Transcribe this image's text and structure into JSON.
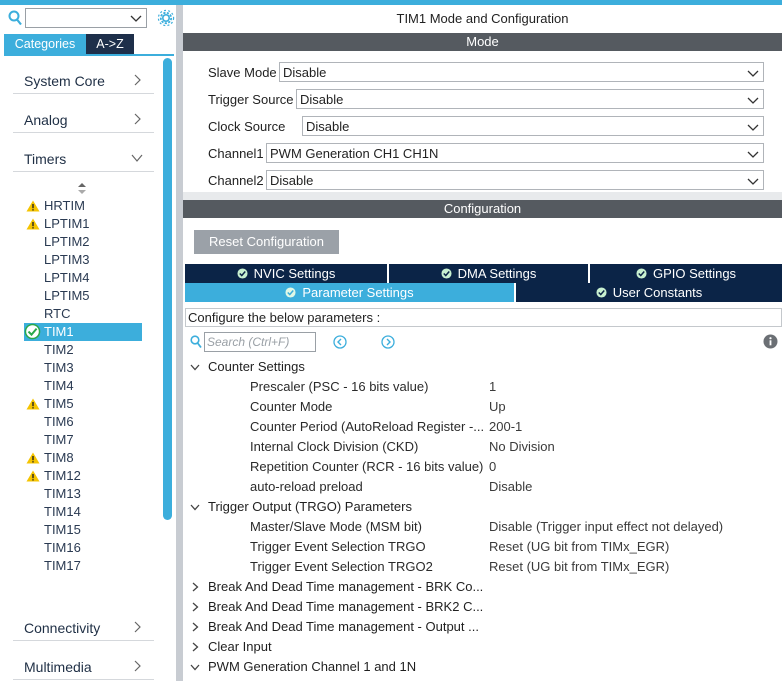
{
  "colors": {
    "accent": "#3caedc",
    "navy": "#0b2447",
    "header_gray": "#555a60",
    "warning": "#f5c400",
    "ok_green": "#2aa84a"
  },
  "sidebar": {
    "search": {
      "value": ""
    },
    "tabs": {
      "categories": "Categories",
      "az": "A->Z"
    },
    "categories": [
      {
        "label": "System Core",
        "icon": "chevron-right-icon"
      },
      {
        "label": "Analog",
        "icon": "chevron-right-icon"
      },
      {
        "label": "Timers",
        "icon": "chevron-down-icon"
      }
    ],
    "timers": [
      {
        "label": "HRTIM",
        "status": "warning"
      },
      {
        "label": "LPTIM1",
        "status": "warning"
      },
      {
        "label": "LPTIM2",
        "status": "none"
      },
      {
        "label": "LPTIM3",
        "status": "none"
      },
      {
        "label": "LPTIM4",
        "status": "none"
      },
      {
        "label": "LPTIM5",
        "status": "none"
      },
      {
        "label": "RTC",
        "status": "none"
      },
      {
        "label": "TIM1",
        "status": "ok"
      },
      {
        "label": "TIM2",
        "status": "none"
      },
      {
        "label": "TIM3",
        "status": "none"
      },
      {
        "label": "TIM4",
        "status": "none"
      },
      {
        "label": "TIM5",
        "status": "warning"
      },
      {
        "label": "TIM6",
        "status": "none"
      },
      {
        "label": "TIM7",
        "status": "none"
      },
      {
        "label": "TIM8",
        "status": "warning"
      },
      {
        "label": "TIM12",
        "status": "warning"
      },
      {
        "label": "TIM13",
        "status": "none"
      },
      {
        "label": "TIM14",
        "status": "none"
      },
      {
        "label": "TIM15",
        "status": "none"
      },
      {
        "label": "TIM16",
        "status": "none"
      },
      {
        "label": "TIM17",
        "status": "none"
      }
    ],
    "bottom_categories": [
      {
        "label": "Connectivity",
        "icon": "chevron-right-icon"
      },
      {
        "label": "Multimedia",
        "icon": "chevron-right-icon"
      }
    ]
  },
  "main": {
    "title": "TIM1 Mode and Configuration",
    "mode_header": "Mode",
    "mode_fields": [
      {
        "label": "Slave Mode",
        "value": "Disable"
      },
      {
        "label": "Trigger Source",
        "value": "Disable"
      },
      {
        "label": "Clock Source",
        "value": "Disable"
      },
      {
        "label": "Channel1",
        "value": "PWM Generation CH1 CH1N"
      },
      {
        "label": "Channel2",
        "value": "Disable"
      }
    ],
    "config_header": "Configuration",
    "reset_button": "Reset Configuration",
    "settings_tabs_row1": [
      "NVIC Settings",
      "DMA Settings",
      "GPIO Settings"
    ],
    "settings_tabs_row2": [
      "Parameter Settings",
      "User Constants"
    ],
    "hint": "Configure the below parameters :",
    "param_search_placeholder": "Search (Ctrl+F)",
    "groups": [
      {
        "title": "Counter Settings",
        "expanded": true,
        "params": [
          {
            "name": "Prescaler (PSC - 16 bits value)",
            "value": "1"
          },
          {
            "name": "Counter Mode",
            "value": "Up"
          },
          {
            "name": "Counter Period (AutoReload Register -...",
            "value": "200-1"
          },
          {
            "name": "Internal Clock Division (CKD)",
            "value": "No Division"
          },
          {
            "name": "Repetition Counter (RCR - 16 bits value)",
            "value": "0"
          },
          {
            "name": "auto-reload preload",
            "value": "Disable"
          }
        ]
      },
      {
        "title": "Trigger Output (TRGO) Parameters",
        "expanded": true,
        "params": [
          {
            "name": "Master/Slave Mode (MSM bit)",
            "value": "Disable (Trigger input effect not delayed)"
          },
          {
            "name": "Trigger Event Selection TRGO",
            "value": "Reset (UG bit from TIMx_EGR)"
          },
          {
            "name": "Trigger Event Selection TRGO2",
            "value": "Reset (UG bit from TIMx_EGR)"
          }
        ]
      },
      {
        "title": "Break And Dead Time management - BRK Co...",
        "expanded": false,
        "params": []
      },
      {
        "title": "Break And Dead Time management - BRK2 C...",
        "expanded": false,
        "params": []
      },
      {
        "title": "Break And Dead Time management - Output ...",
        "expanded": false,
        "params": []
      },
      {
        "title": "Clear Input",
        "expanded": false,
        "params": []
      },
      {
        "title": "PWM Generation Channel 1 and 1N",
        "expanded": true,
        "params": []
      }
    ]
  }
}
